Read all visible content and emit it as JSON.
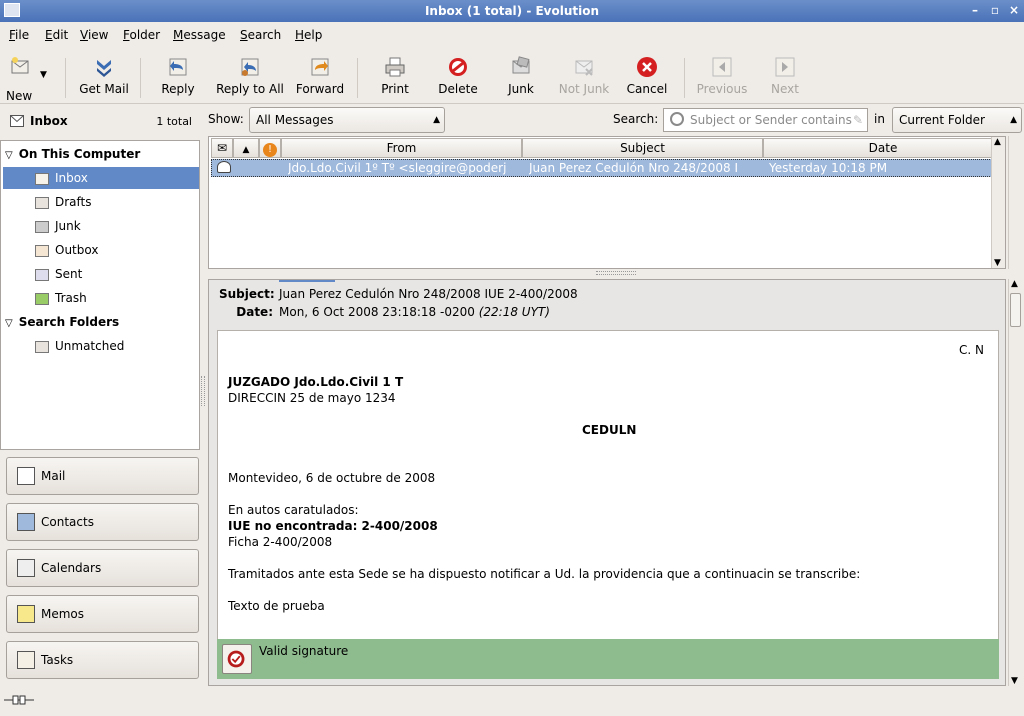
{
  "window": {
    "title": "Inbox (1 total) - Evolution"
  },
  "menu": [
    "File",
    "Edit",
    "View",
    "Folder",
    "Message",
    "Search",
    "Help"
  ],
  "toolbar": {
    "new": "New",
    "get_mail": "Get Mail",
    "reply": "Reply",
    "reply_all": "Reply to All",
    "forward": "Forward",
    "print": "Print",
    "delete": "Delete",
    "junk": "Junk",
    "not_junk": "Not Junk",
    "cancel": "Cancel",
    "previous": "Previous",
    "next": "Next"
  },
  "folderpane": {
    "title": "Inbox",
    "count": "1 total"
  },
  "tree": {
    "group1": "On This Computer",
    "items": [
      "Inbox",
      "Drafts",
      "Junk",
      "Outbox",
      "Sent",
      "Trash"
    ],
    "group2": "Search Folders",
    "search_items": [
      "Unmatched"
    ]
  },
  "switcher": [
    "Mail",
    "Contacts",
    "Calendars",
    "Memos",
    "Tasks"
  ],
  "filter": {
    "show_label": "Show:",
    "show_value": "All Messages",
    "search_label": "Search:",
    "search_placeholder": "Subject or Sender contains",
    "in_label": "in",
    "scope": "Current Folder"
  },
  "columns": {
    "from": "From",
    "subject": "Subject",
    "date": "Date"
  },
  "messages": [
    {
      "from": "Jdo.Ldo.Civil 1º Tº <sleggire@poderj",
      "subject": "Juan Perez Cedulón Nro 248/2008 I",
      "date": "Yesterday 10:18 PM"
    }
  ],
  "preview": {
    "subject_label": "Subject:",
    "subject": "Juan Perez Cedulón Nro 248/2008 IUE 2-400/2008",
    "date_label": "Date:",
    "date": "Mon,  6 Oct 2008 23:18:18 -0200",
    "date_local": "(22:18 UYT)",
    "body": {
      "cn": "C. N",
      "court": "JUZGADO Jdo.Ldo.Civil 1 T",
      "address": "DIRECCIN 25 de mayo 1234",
      "heading": "CEDULN",
      "place_date": "Montevideo, 6 de octubre de 2008",
      "autos": "En autos caratulados:",
      "iue": "IUE no encontrada: 2-400/2008",
      "ficha": "Ficha 2-400/2008",
      "tramitados": "Tramitados ante esta Sede se ha dispuesto notificar a Ud. la providencia que a continuacin se transcribe:",
      "texto": "Texto de prueba"
    },
    "signature": "Valid signature"
  }
}
